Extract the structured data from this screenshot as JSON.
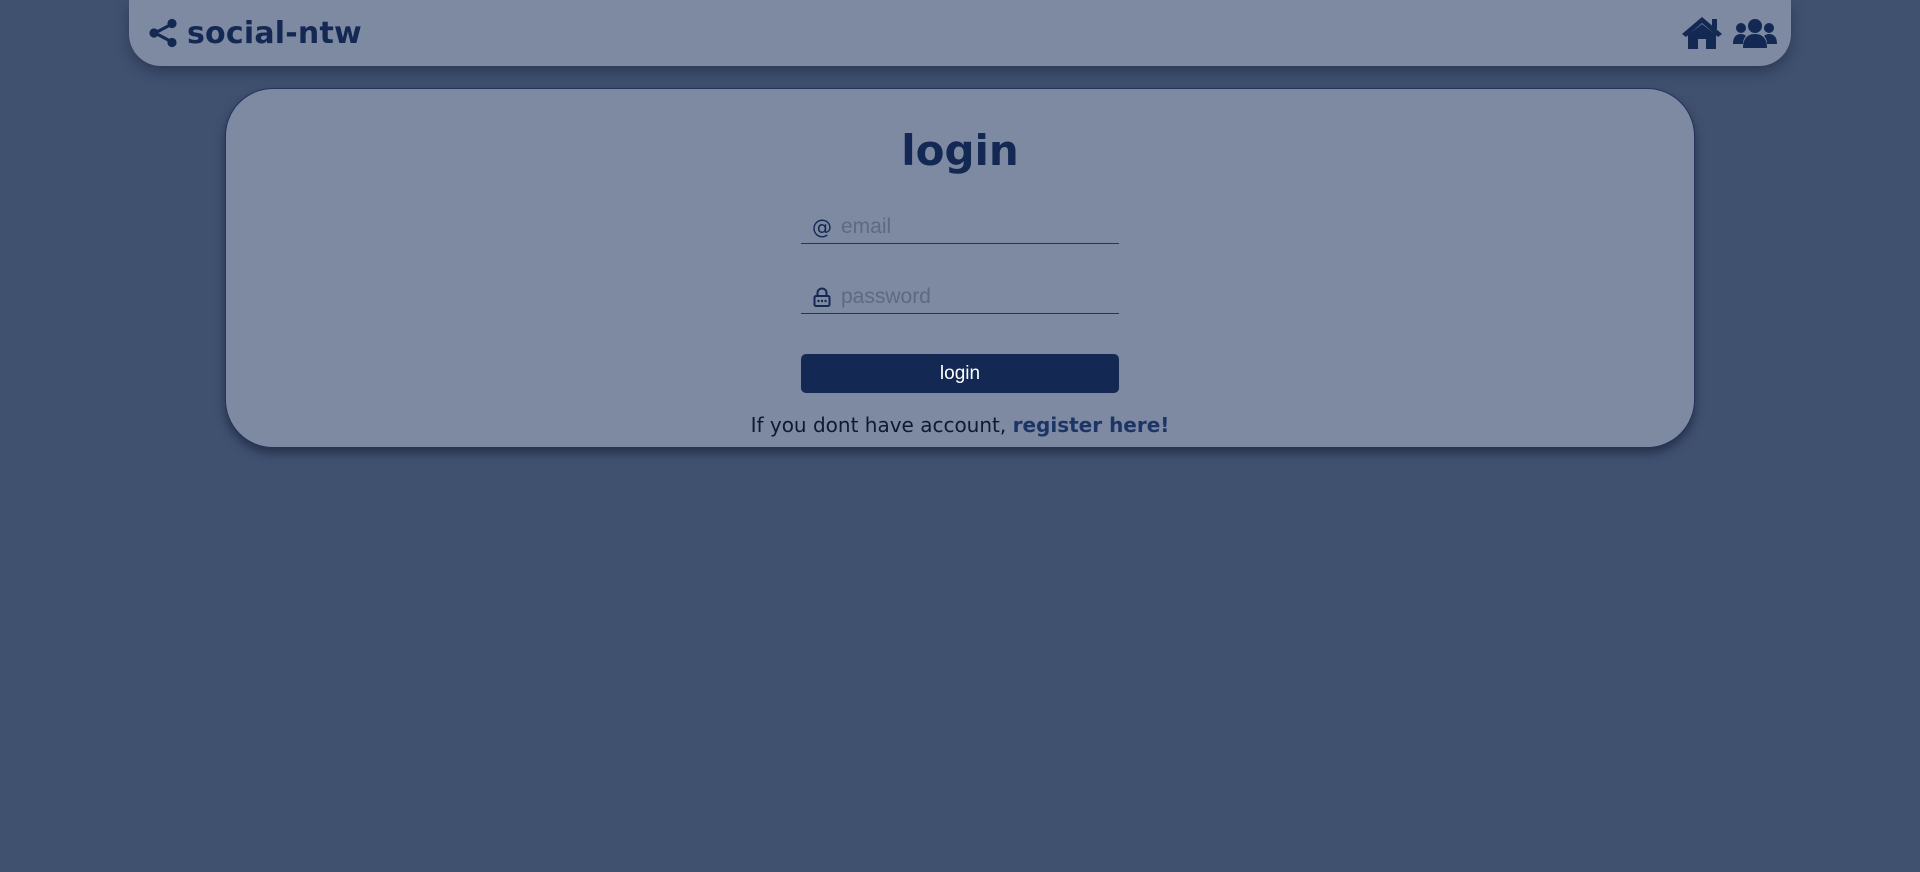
{
  "navbar": {
    "brand_name": "social-ntw",
    "brand_icon": "share-icon",
    "nav_icons": [
      "home-icon",
      "users-icon"
    ]
  },
  "login_form": {
    "title": "login",
    "email_placeholder": "email",
    "email_icon": "at-icon",
    "email_icon_glyph": "@",
    "password_placeholder": "password",
    "password_icon": "lock-icon",
    "submit_label": "login",
    "register_prompt": "If you dont have account,",
    "register_link": "register here!"
  },
  "colors": {
    "page_background": "#405170",
    "panel_background": "#7e89a2",
    "primary": "#132853",
    "link": "#1d3566",
    "button_text": "#ffffff"
  }
}
